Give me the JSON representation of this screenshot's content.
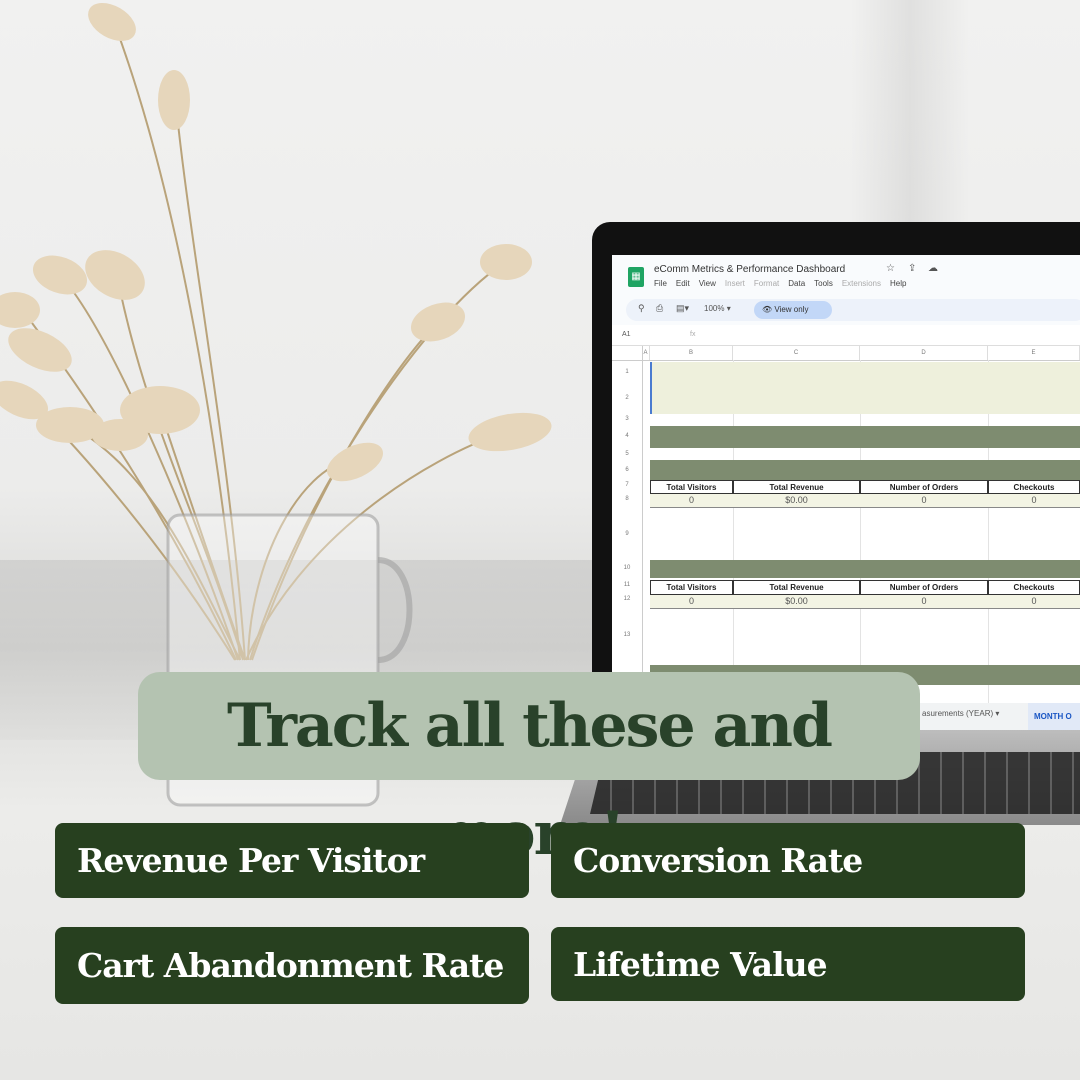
{
  "headline": "Track all these and more!",
  "metrics": [
    "Revenue Per Visitor",
    "Conversion Rate",
    "Cart Abandonment Rate",
    "Lifetime Value"
  ],
  "colors": {
    "pill": "#b4c3b1",
    "tag": "#27401f",
    "text_dark": "#29422a",
    "band": "#7e8c70"
  },
  "sheet": {
    "title": "eComm Metrics & Performance Dashboard",
    "menu": [
      "File",
      "Edit",
      "View",
      "Insert",
      "Format",
      "Data",
      "Tools",
      "Extensions",
      "Help"
    ],
    "zoom": "100%",
    "view_only": "View only",
    "cell_ref": "A1",
    "fx": "fx",
    "columns": [
      "A",
      "B",
      "C",
      "D",
      "E"
    ],
    "rows": [
      "1",
      "2",
      "3",
      "4",
      "5",
      "6",
      "7",
      "8",
      "9",
      "10",
      "11",
      "12",
      "13"
    ],
    "headers": [
      "Total Visitors",
      "Total Revenue",
      "Number of Orders",
      "Checkouts"
    ],
    "values_1": [
      "0",
      "$0.00",
      "0",
      "0"
    ],
    "values_2": [
      "0",
      "$0.00",
      "0",
      "0"
    ],
    "tab_partial": "asurements (YEAR)",
    "tab_active": "MONTH O"
  }
}
